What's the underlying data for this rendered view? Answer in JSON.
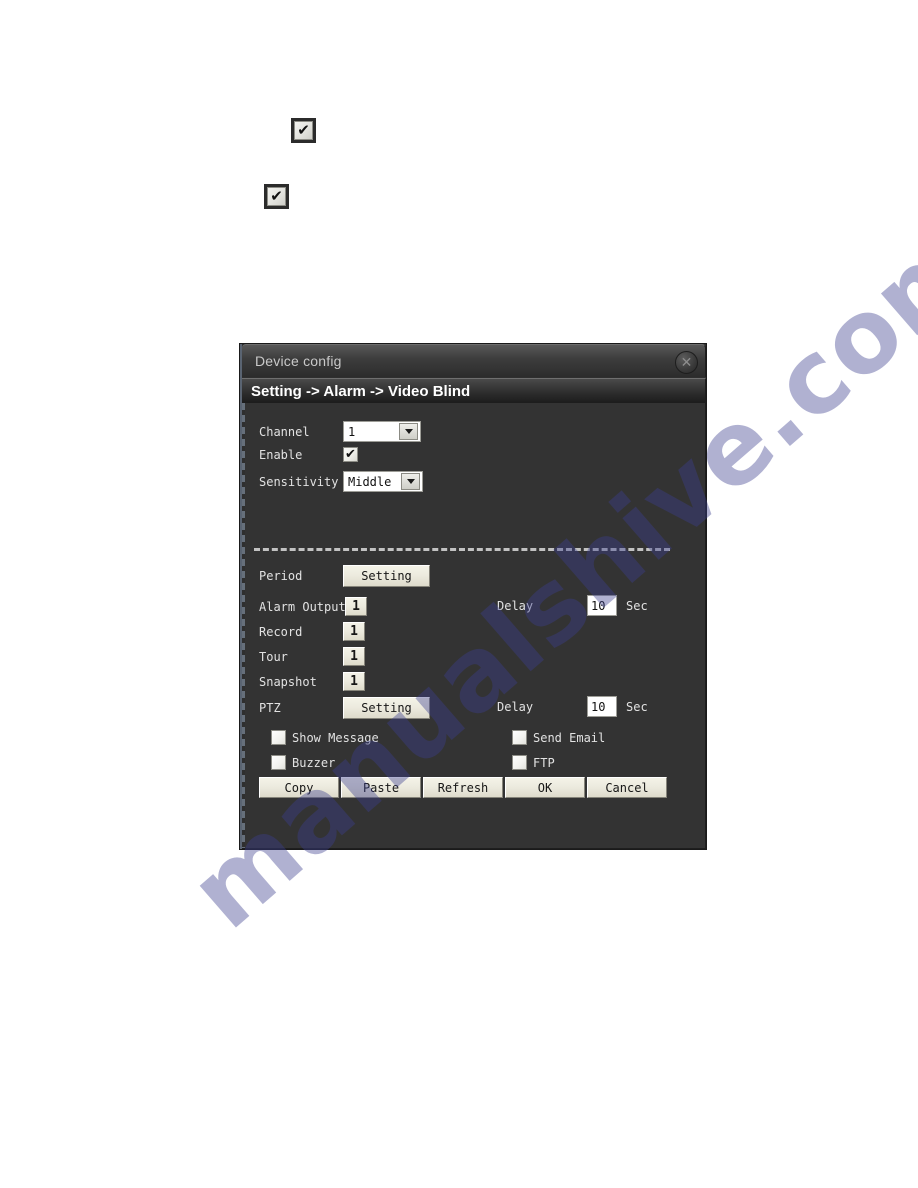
{
  "page": {
    "watermark": "manualshive.com",
    "standalone_checkbox_glyph": "✔"
  },
  "dialog": {
    "title": "Device config",
    "close_icon": "✕",
    "breadcrumb": "Setting -> Alarm -> Video Blind",
    "fields": {
      "channel": {
        "label": "Channel",
        "value": "1"
      },
      "enable": {
        "label": "Enable",
        "checked": true,
        "glyph": "✔"
      },
      "sensitivity": {
        "label": "Sensitivity",
        "value": "Middle"
      },
      "period": {
        "label": "Period",
        "button": "Setting"
      },
      "alarm_output": {
        "label": "Alarm Output",
        "value": "1"
      },
      "record": {
        "label": "Record",
        "value": "1"
      },
      "tour": {
        "label": "Tour",
        "value": "1"
      },
      "snapshot": {
        "label": "Snapshot",
        "value": "1"
      },
      "ptz": {
        "label": "PTZ",
        "button": "Setting"
      },
      "delay_alarm": {
        "label": "Delay",
        "value": "10",
        "unit": "Sec"
      },
      "delay_ptz": {
        "label": "Delay",
        "value": "10",
        "unit": "Sec"
      },
      "show_message": {
        "label": "Show Message",
        "checked": false
      },
      "buzzer": {
        "label": "Buzzer",
        "checked": false
      },
      "send_email": {
        "label": "Send Email",
        "checked": false
      },
      "ftp": {
        "label": "FTP",
        "checked": false
      }
    },
    "buttons": {
      "copy": "Copy",
      "paste": "Paste",
      "refresh": "Refresh",
      "ok": "OK",
      "cancel": "Cancel"
    }
  },
  "colors": {
    "window_body": "#333333",
    "titlebar_text": "#c9c9c9",
    "breadcrumb_text": "#ffffff",
    "button_face": "#ecead e",
    "watermark": "#3b3f8f",
    "field_background": "#ffffff"
  }
}
